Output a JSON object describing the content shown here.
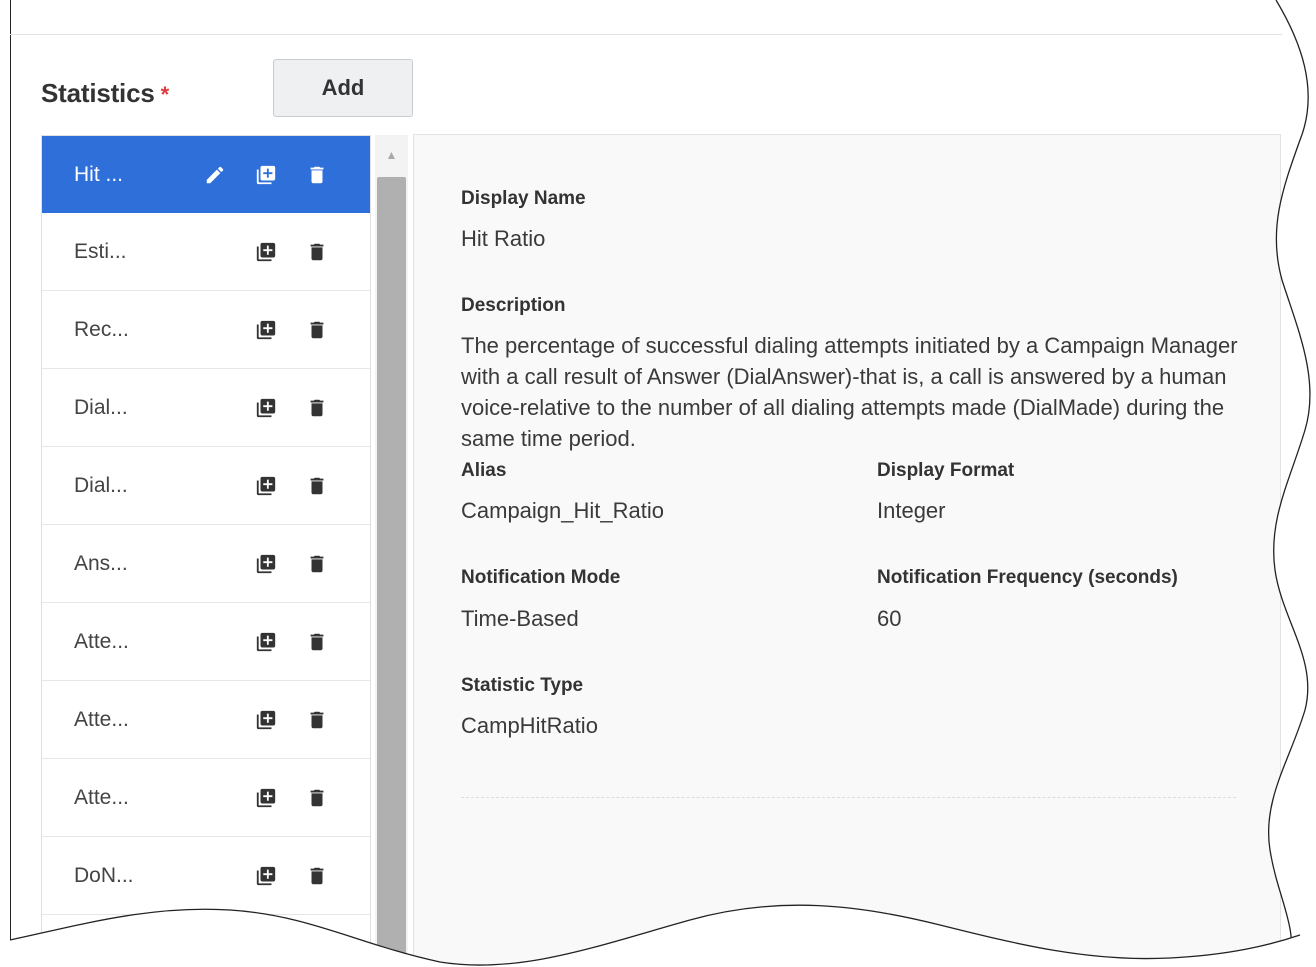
{
  "statistics_section": {
    "title": "Statistics",
    "required_marker": "*",
    "add_button_label": "Add"
  },
  "statistics_list": [
    {
      "label": "Hit ...",
      "selected": true,
      "show_edit": true
    },
    {
      "label": "Esti...",
      "selected": false,
      "show_edit": false
    },
    {
      "label": "Rec...",
      "selected": false,
      "show_edit": false
    },
    {
      "label": "Dial...",
      "selected": false,
      "show_edit": false
    },
    {
      "label": "Dial...",
      "selected": false,
      "show_edit": false
    },
    {
      "label": "Ans...",
      "selected": false,
      "show_edit": false
    },
    {
      "label": "Atte...",
      "selected": false,
      "show_edit": false
    },
    {
      "label": "Atte...",
      "selected": false,
      "show_edit": false
    },
    {
      "label": "Atte...",
      "selected": false,
      "show_edit": false
    },
    {
      "label": "DoN...",
      "selected": false,
      "show_edit": false
    }
  ],
  "icons": {
    "edit": "pencil-icon",
    "copy": "copy-icon",
    "delete": "trash-icon",
    "scroll_up": "caret-up-icon"
  },
  "details": {
    "display_name_label": "Display Name",
    "display_name_value": "Hit Ratio",
    "description_label": "Description",
    "description_value": "The percentage of successful dialing attempts initiated by a Campaign Manager with a call result of Answer (DialAnswer)-that is, a call is answered by a human voice-relative to the number of all dialing attempts made (DialMade) during the same time period.",
    "alias_label": "Alias",
    "alias_value": "Campaign_Hit_Ratio",
    "display_format_label": "Display Format",
    "display_format_value": "Integer",
    "notification_mode_label": "Notification Mode",
    "notification_mode_value": "Time-Based",
    "notification_frequency_label": "Notification Frequency (seconds)",
    "notification_frequency_value": "60",
    "statistic_type_label": "Statistic Type",
    "statistic_type_value": "CampHitRatio"
  },
  "colors": {
    "selected_item": "#2e6fd9",
    "required_marker": "#e0393e"
  }
}
